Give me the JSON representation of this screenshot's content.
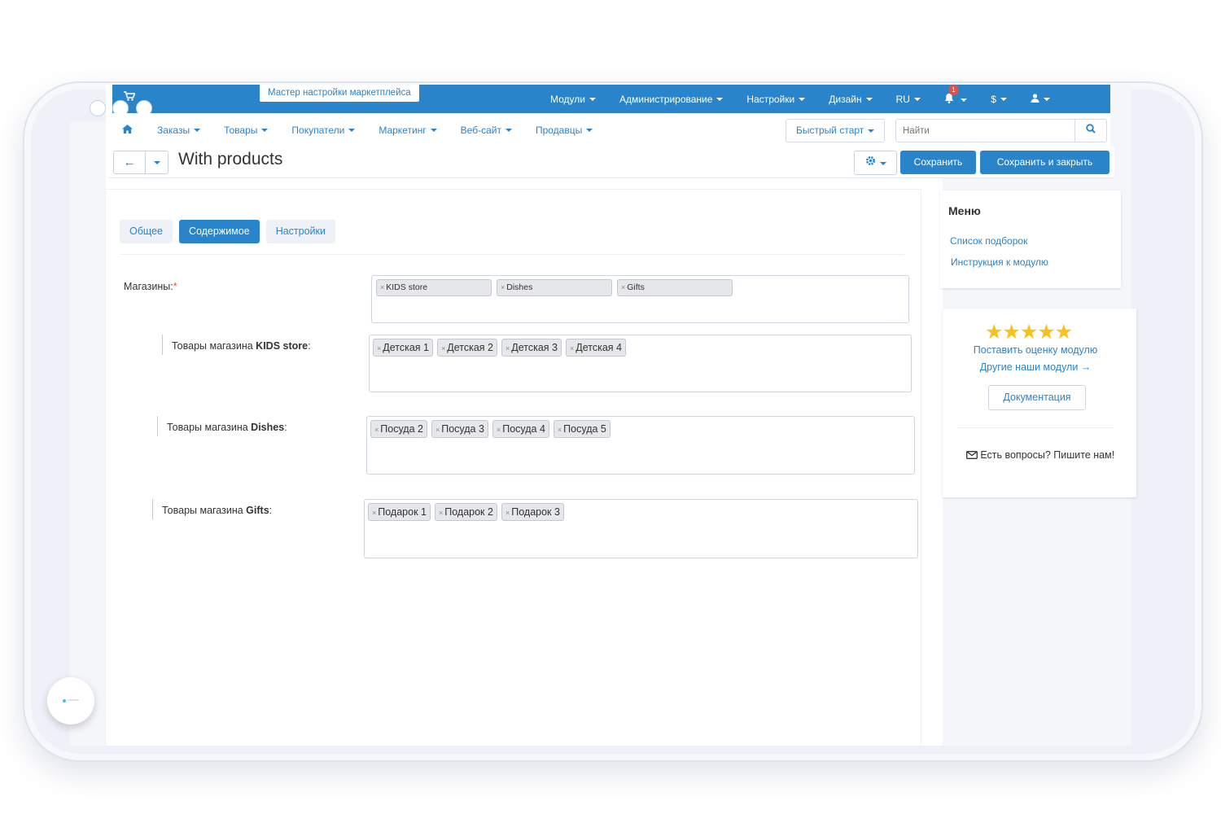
{
  "topbar": {
    "wizard_label": "Мастер настройки маркетплейса",
    "menu": [
      "Модули",
      "Администрирование",
      "Настройки",
      "Дизайн",
      "RU",
      "$"
    ],
    "notification_count": "1"
  },
  "nav": {
    "items": [
      "Заказы",
      "Товары",
      "Покупатели",
      "Маркетинг",
      "Веб-сайт",
      "Продавцы"
    ],
    "quick_start": "Быстрый старт",
    "search_placeholder": "Найти"
  },
  "titlebar": {
    "title": "With products",
    "save": "Сохранить",
    "save_close": "Сохранить и закрыть"
  },
  "tabs": [
    "Общее",
    "Содержимое",
    "Настройки"
  ],
  "active_tab": "Содержимое",
  "form": {
    "stores_label": "Магазины:",
    "required_mark": "*",
    "stores": [
      "KIDS store",
      "Dishes",
      "Gifts"
    ],
    "label_prefix": "Товары магазина",
    "store_products": [
      {
        "store": "KIDS store",
        "products": [
          "Детская 1",
          "Детская 2",
          "Детская 3",
          "Детская 4"
        ]
      },
      {
        "store": "Dishes",
        "products": [
          "Посуда 2",
          "Посуда 3",
          "Посуда 4",
          "Посуда 5"
        ]
      },
      {
        "store": "Gifts",
        "products": [
          "Подарок 1",
          "Подарок 2",
          "Подарок 3"
        ]
      }
    ]
  },
  "sidebar": {
    "menu_title": "Меню",
    "links": [
      "Список подборок",
      "Инструкция к модулю"
    ],
    "stars": "★★★★★",
    "rate_link": "Поставить оценку модулю",
    "other_modules": "Другие наши модули →",
    "docs_button": "Документация",
    "questions": "Есть вопросы? Пишите нам!"
  },
  "colors": {
    "accent": "#2a84c9",
    "star": "#f6c21b",
    "required": "#d9534f"
  }
}
